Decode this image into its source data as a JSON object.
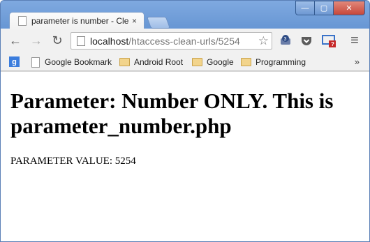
{
  "tab": {
    "title": "parameter is number - Cle",
    "close": "×"
  },
  "window": {
    "minimize": "—",
    "maximize": "▢",
    "close": "✕"
  },
  "toolbar": {
    "back": "←",
    "forward": "→",
    "reload": "↻",
    "url_host": "localhost",
    "url_path": "/htaccess-clean-urls/5254",
    "star": "☆",
    "menu": "≡"
  },
  "bookmarks": {
    "apps_label": "g",
    "items": [
      {
        "label": "Google Bookmark",
        "icon": "page-icon"
      },
      {
        "label": "Android Root",
        "icon": "folder-icon"
      },
      {
        "label": "Google",
        "icon": "folder-icon"
      },
      {
        "label": "Programming",
        "icon": "folder-icon"
      }
    ],
    "more": "»"
  },
  "content": {
    "heading": "Parameter: Number ONLY. This is parameter_number.php",
    "param_label": "PARAMETER VALUE: 5254"
  }
}
